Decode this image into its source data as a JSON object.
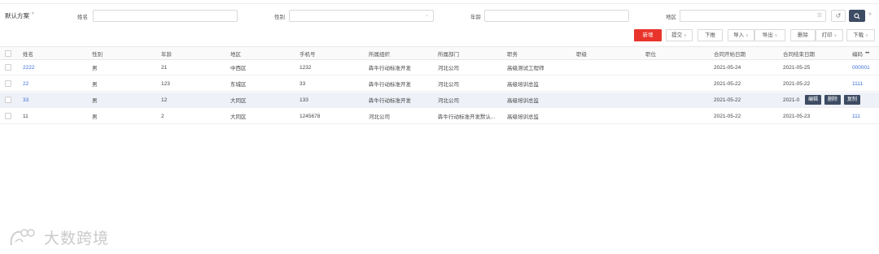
{
  "filters": {
    "scheme": "默认方案",
    "name_label": "姓名",
    "gender_label": "性别",
    "age_label": "年龄",
    "region_label": "地区"
  },
  "toolbar": {
    "add": "新增",
    "submit": "提交",
    "push": "下推",
    "import": "导入",
    "export": "导出",
    "delete": "删除",
    "print": "打印",
    "download": "下载"
  },
  "columns": [
    "姓名",
    "性别",
    "年龄",
    "地区",
    "手机号",
    "所属组织",
    "所属部门",
    "职务",
    "职级",
    "职位",
    "合同开始日期",
    "合同结束日期",
    "编码"
  ],
  "rows": [
    [
      "2222",
      "男",
      "21",
      "中西区",
      "1232",
      "犇牛行动标准开发",
      "河北公司",
      "高级测试工程师",
      "",
      "",
      "2021-05-24",
      "2021-05-25",
      "000001"
    ],
    [
      "22",
      "男",
      "123",
      "东城区",
      "33",
      "犇牛行动标准开发",
      "河北公司",
      "高级培训总监",
      "",
      "",
      "2021-05-22",
      "2021-05-22",
      "1111"
    ],
    [
      "33",
      "男",
      "12",
      "大同区",
      "133",
      "犇牛行动标准开发",
      "河北公司",
      "高级培训总监",
      "",
      "",
      "2021-05-22",
      "2021-0",
      ""
    ],
    [
      "11",
      "男",
      "2",
      "大同区",
      "1245678",
      "河北公司",
      "犇牛行动标准开发默认...",
      "高级培训总监",
      "",
      "",
      "2021-05-22",
      "2021-05-23",
      "111"
    ]
  ],
  "row_actions": {
    "edit": "编辑",
    "delete": "删除",
    "copy": "复制"
  },
  "watermark": "大数跨境",
  "colors": {
    "primary_red": "#e8342b",
    "dark_button": "#3d4b63",
    "link_blue": "#3a6fd8",
    "hover_row": "#eef1f7"
  }
}
